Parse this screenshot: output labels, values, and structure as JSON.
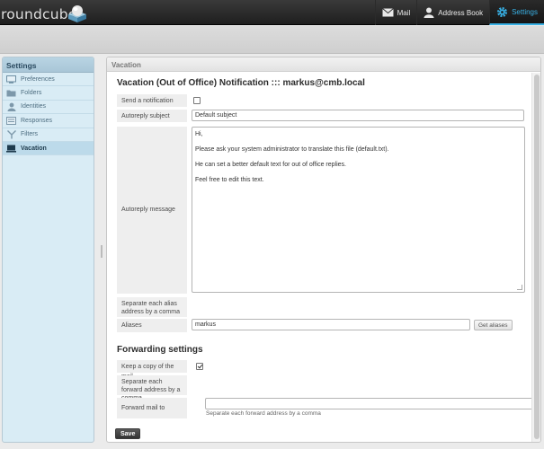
{
  "app": {
    "logo_text": "roundcube"
  },
  "nav": {
    "mail": "Mail",
    "address_book": "Address Book",
    "settings": "Settings"
  },
  "sidebar": {
    "title": "Settings",
    "items": [
      {
        "label": "Preferences",
        "icon": "preferences-icon"
      },
      {
        "label": "Folders",
        "icon": "folder-icon"
      },
      {
        "label": "Identities",
        "icon": "identity-icon"
      },
      {
        "label": "Responses",
        "icon": "responses-icon"
      },
      {
        "label": "Filters",
        "icon": "filter-icon"
      },
      {
        "label": "Vacation",
        "icon": "vacation-icon",
        "selected": true
      }
    ]
  },
  "main": {
    "header": "Vacation",
    "title": "Vacation (Out of Office) Notification ::: markus@cmb.local",
    "send_notification": {
      "label": "Send a notification",
      "checked": false
    },
    "autoreply_subject": {
      "label": "Autoreply subject",
      "value": "Default subject"
    },
    "autoreply_message": {
      "label": "Autoreply message",
      "lines": [
        "Hi,",
        "Please ask your system administrator to translate this file (default.txt).",
        "He can set a better default text for out of office replies.",
        "Feel free to edit this text."
      ]
    },
    "alias_note": "Separate each alias address by a comma",
    "aliases": {
      "label": "Aliases",
      "value": "markus",
      "button": "Get aliases"
    },
    "forwarding_title": "Forwarding settings",
    "keep_copy": {
      "label": "Keep a copy of the mail",
      "checked": true
    },
    "forward_note": "Separate each forward address by a comma",
    "forward_to": {
      "label": "Forward mail to",
      "value": "",
      "hint": "Separate each forward address by a comma"
    },
    "save": "Save"
  },
  "colors": {
    "accent": "#37b0e5",
    "topbar": "#2a2a2a",
    "sidebar_bg": "#d9ecf5"
  }
}
